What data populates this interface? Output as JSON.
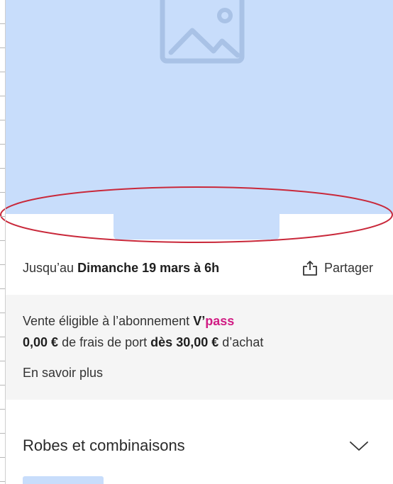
{
  "hero": {
    "placeholder_icon": "image-placeholder-icon",
    "background_color": "#c8ddfb",
    "annotation_color": "#c9283a"
  },
  "sale": {
    "prefix": "Jusqu’au",
    "deadline": "Dimanche 19 mars à 6h",
    "share_label": "Partager",
    "share_icon": "share-icon"
  },
  "promo": {
    "line1_text": "Vente éligible à l’abonnement",
    "brand_v": "V’",
    "brand_pass": "pass",
    "brand_pass_color": "#d11d84",
    "shipping_price": "0,00 €",
    "shipping_text": "de frais de port",
    "threshold_prefix": "dès",
    "threshold_value": "30,00 €",
    "threshold_suffix": "d’achat",
    "learn_more": "En savoir plus"
  },
  "category": {
    "title": "Robes et combinaisons",
    "toggle_icon": "chevron-down-icon"
  }
}
